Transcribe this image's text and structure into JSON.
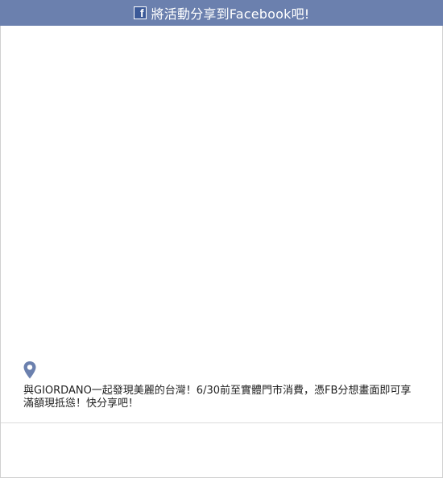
{
  "header": {
    "icon": "facebook-f-icon",
    "title": "將活動分享到Facebook吧!"
  },
  "share": {
    "location_icon": "map-pin-icon",
    "description": "與GIORDANO一起發現美麗的台灣！6/30前至實體門市消費，憑FB分想畫面即可享滿額現抵慫！快分享吧！"
  },
  "colors": {
    "header_bg": "#6b80ae",
    "fb_blue": "#3b5998",
    "pin": "#6b80ae"
  }
}
